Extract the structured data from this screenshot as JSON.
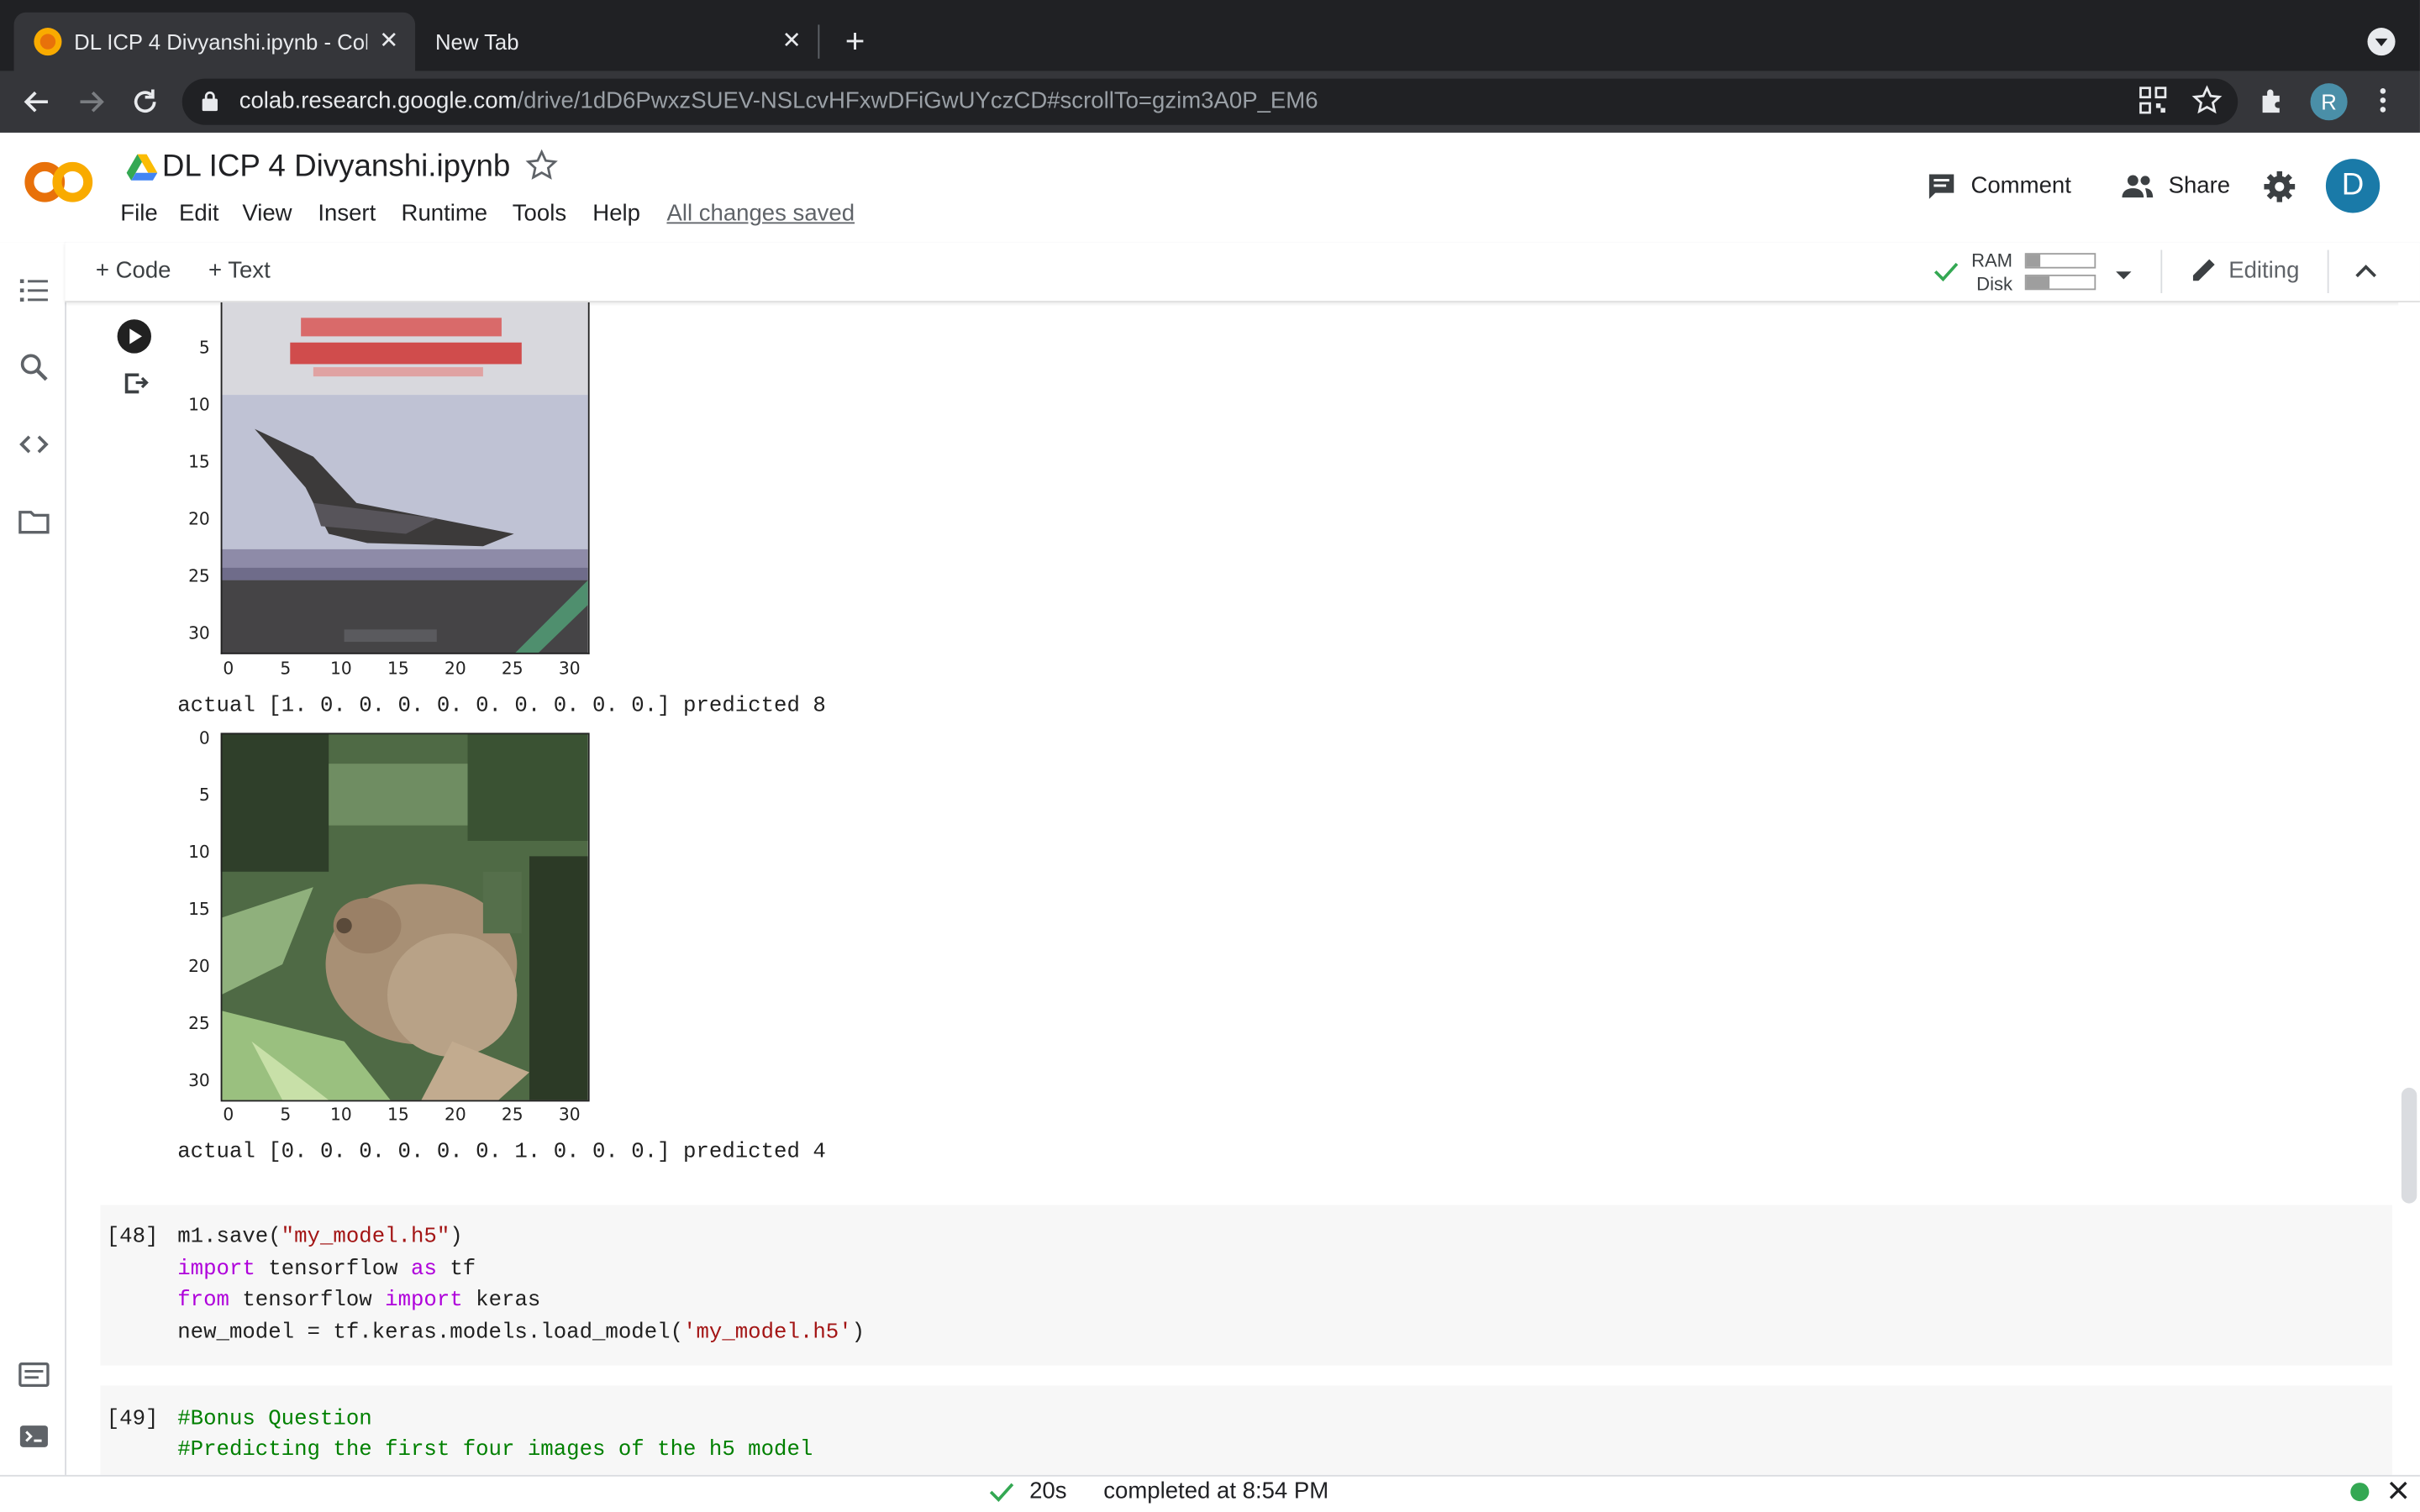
{
  "browser": {
    "active_tab": {
      "title": "DL ICP 4 Divyanshi.ipynb - Colab",
      "close": "✕"
    },
    "second_tab": {
      "title": "New Tab",
      "close": "✕"
    },
    "new_tab": "+",
    "url": {
      "host": "colab.research.google.com",
      "path": "/drive/1dD6PwxzSUEV-NSLcvHFxwDFiGwUYczCD#scrollTo=gzim3A0P_EM6"
    },
    "profile_initial": "R"
  },
  "colab": {
    "notebook_title": "DL ICP 4 Divyanshi.ipynb",
    "menu": [
      "File",
      "Edit",
      "View",
      "Insert",
      "Runtime",
      "Tools",
      "Help"
    ],
    "save_status": "All changes saved",
    "comment_label": "Comment",
    "share_label": "Share",
    "avatar_initial": "D",
    "toolbar": {
      "add_code": "+ Code",
      "add_text": "+ Text",
      "ram_label": "RAM",
      "disk_label": "Disk",
      "ram_usage": 0.2,
      "disk_usage": 0.35,
      "editing_label": "Editing"
    }
  },
  "outputs": {
    "image1": {
      "description_hidden": false,
      "y_ticks": [
        "5",
        "10",
        "15",
        "20",
        "25",
        "30"
      ],
      "x_ticks": [
        "0",
        "5",
        "10",
        "15",
        "20",
        "25",
        "30"
      ],
      "caption": "actual [1. 0. 0. 0. 0. 0. 0. 0. 0. 0.] predicted 8"
    },
    "image2": {
      "y_ticks": [
        "0",
        "5",
        "10",
        "15",
        "20",
        "25",
        "30"
      ],
      "x_ticks": [
        "0",
        "5",
        "10",
        "15",
        "20",
        "25",
        "30"
      ],
      "caption": "actual [0. 0. 0. 0. 0. 0. 1. 0. 0. 0.] predicted 4"
    }
  },
  "cells": {
    "cell48": {
      "count": "[48]",
      "line1_a": "m1.save(",
      "line1_str": "\"my_model.h5\"",
      "line1_b": ")",
      "line2_kw1": "import",
      "line2_a": " tensorflow ",
      "line2_kw2": "as",
      "line2_b": " tf",
      "line3_kw1": "from",
      "line3_a": " tensorflow ",
      "line3_kw2": "import",
      "line3_b": " keras",
      "line4_a": "new_model = tf.keras.models.load_model(",
      "line4_str": "'my_model.h5'",
      "line4_b": ")"
    },
    "cell49": {
      "count": "[49]",
      "line1": "#Bonus Question",
      "line2": "#Predicting the first four images of the h5 model"
    }
  },
  "status": {
    "duration": "20s",
    "completed": "completed at 8:54 PM"
  }
}
